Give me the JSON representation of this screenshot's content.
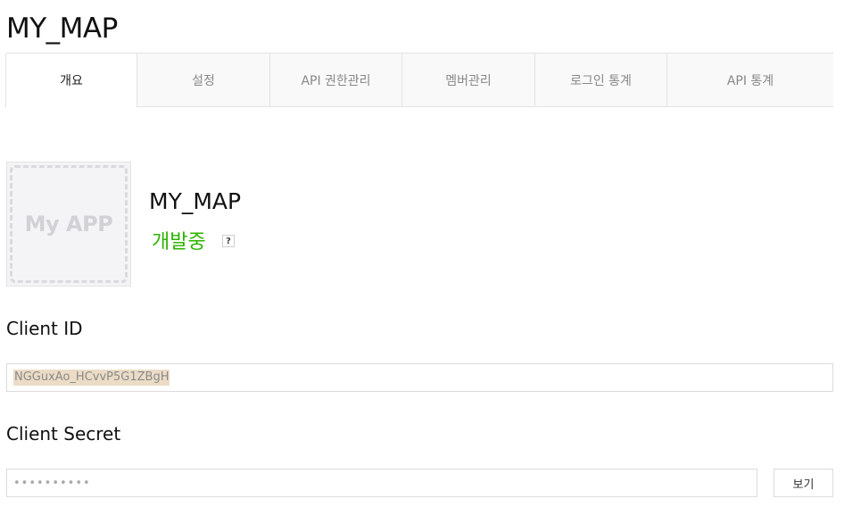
{
  "page": {
    "title": "MY_MAP"
  },
  "tabs": [
    {
      "label": "개요",
      "active": true
    },
    {
      "label": "설정",
      "active": false
    },
    {
      "label": "API 권한관리",
      "active": false
    },
    {
      "label": "멤버관리",
      "active": false
    },
    {
      "label": "로그인 통계",
      "active": false
    },
    {
      "label": "API 통계",
      "active": false
    }
  ],
  "app": {
    "thumbnail_text": "My APP",
    "name": "MY_MAP",
    "status": "개발중",
    "status_color": "#2db400",
    "help_icon": "?"
  },
  "client_id": {
    "label": "Client ID",
    "value": "NGGuxAo_HCvvP5G1ZBgH"
  },
  "client_secret": {
    "label": "Client Secret",
    "value": "••••••••••",
    "show_button_label": "보기"
  }
}
